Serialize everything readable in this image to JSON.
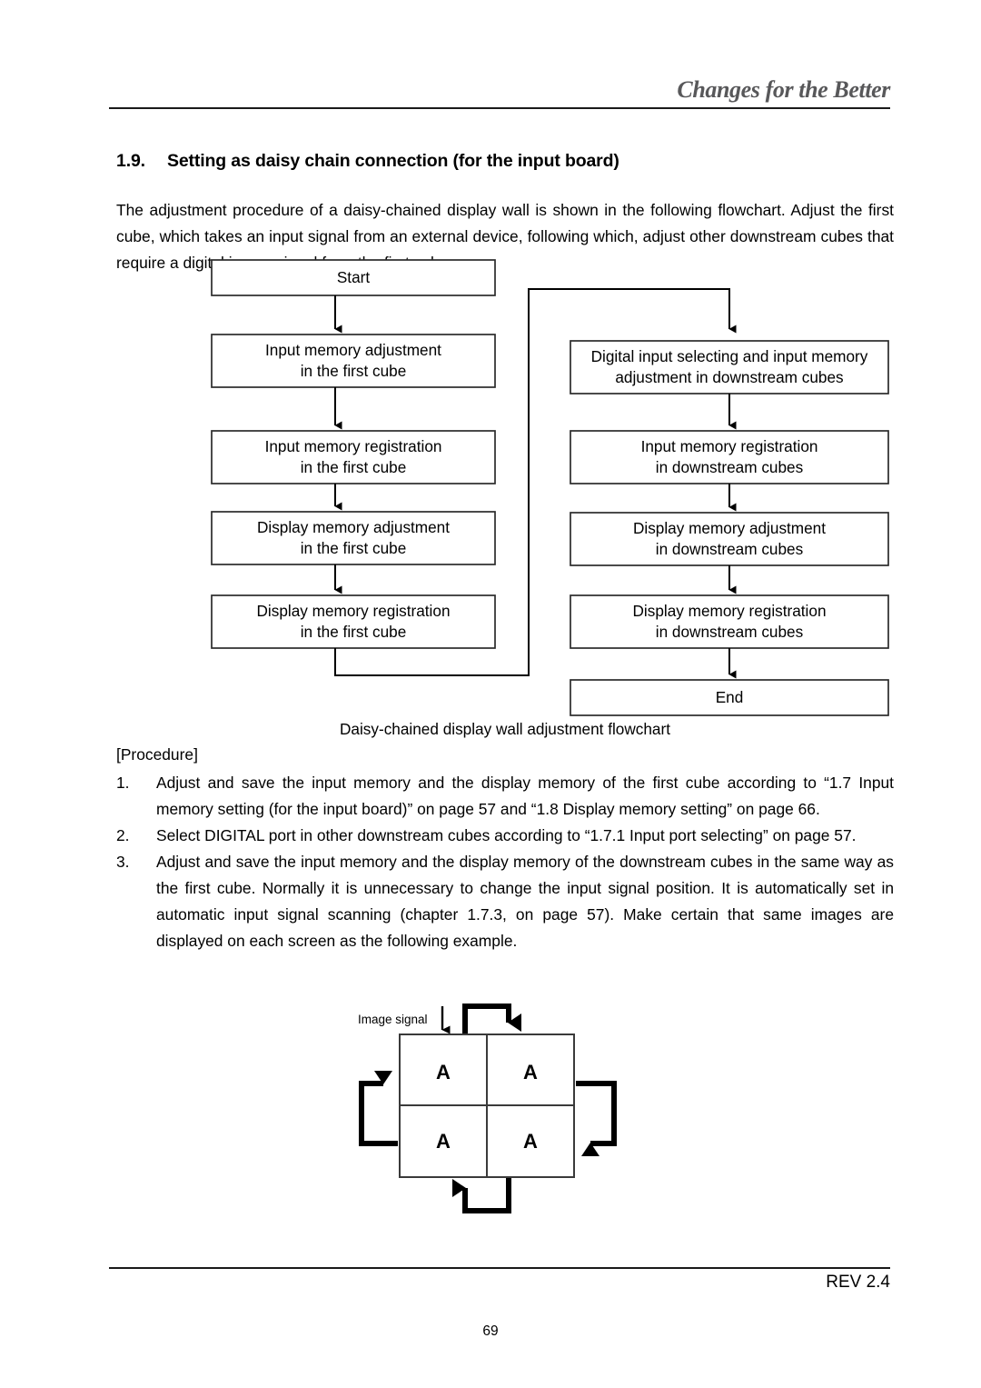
{
  "header": {
    "tagline": "Changes for the Better",
    "rule_color": "#1a1a1a",
    "tagline_color": "#58585a"
  },
  "section": {
    "number": "1.9.",
    "title": "Setting as daisy chain connection (for the input board)"
  },
  "intro": {
    "paragraph": "The adjustment procedure of a daisy-chained display wall is shown in the following flowchart. Adjust the first cube, which takes an input signal from an external device, following which, adjust other downstream cubes that require a digital image signal from the first cube."
  },
  "flowchart": {
    "caption": "Daisy-chained display wall adjustment flowchart",
    "left_column": [
      {
        "line1": "Start",
        "line2": ""
      },
      {
        "line1": "Input memory adjustment",
        "line2": "in the first cube"
      },
      {
        "line1": "Input memory registration",
        "line2": "in the first cube"
      },
      {
        "line1": "Display memory adjustment",
        "line2": "in the first cube"
      },
      {
        "line1": "Display memory registration",
        "line2": "in the first cube"
      }
    ],
    "right_column": [
      {
        "line1": "Digital input selecting and input memory",
        "line2": "adjustment in downstream cubes"
      },
      {
        "line1": "Input memory registration",
        "line2": "in downstream cubes"
      },
      {
        "line1": "Display memory adjustment",
        "line2": "in downstream cubes"
      },
      {
        "line1": "Display memory registration",
        "line2": "in downstream cubes"
      },
      {
        "line1": "End",
        "line2": ""
      }
    ]
  },
  "procedure": {
    "label": "[Procedure]",
    "items": [
      {
        "number": "1.",
        "text": "Adjust and save the input memory and the display memory of the first cube according to “1.7 Input memory setting (for the input board)” on page 57 and “1.8 Display memory setting” on page 66."
      },
      {
        "number": "2.",
        "text": "Select DIGITAL port in other downstream cubes according to “1.7.1 Input port selecting” on page 57."
      },
      {
        "number": "3.",
        "text": "Adjust and save the input memory and the display memory of the downstream cubes in the same way as the first cube. Normally it is unnecessary to change the input signal position. It is automatically set in automatic input signal scanning (chapter 1.7.3, on page 57). Make certain that same images are displayed on each screen as the following example."
      }
    ]
  },
  "cube_diagram": {
    "image_signal_label": "Image signal",
    "cells": [
      {
        "label": "A"
      },
      {
        "label": "A"
      },
      {
        "label": "A"
      },
      {
        "label": "A"
      }
    ]
  },
  "footer": {
    "revision": "REV 2.4",
    "page_number": "69"
  }
}
